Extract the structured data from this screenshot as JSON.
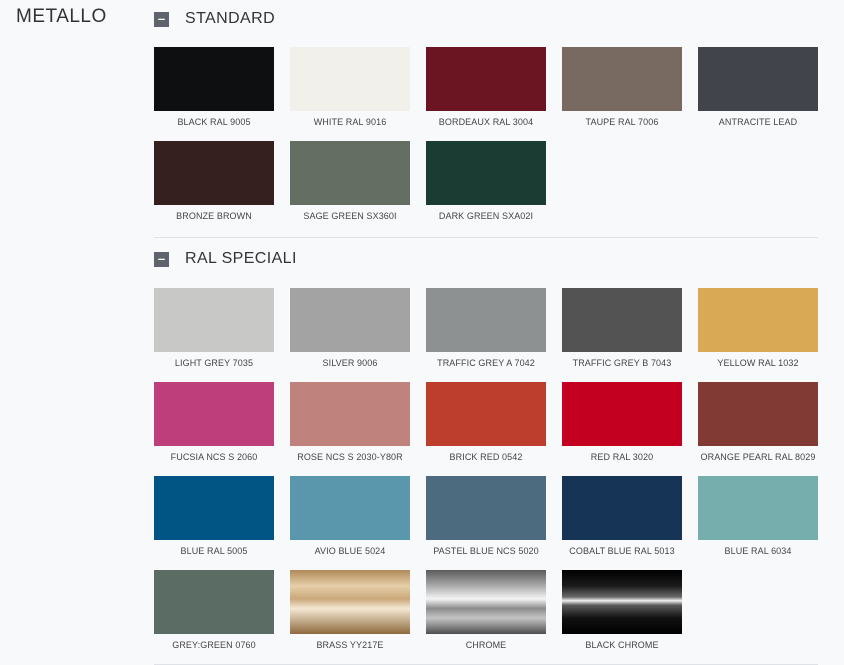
{
  "page_title": "METALLO",
  "toggle_symbol": "–",
  "sections": [
    {
      "title": "STANDARD",
      "swatches": [
        {
          "label": "BLACK RAL 9005",
          "color": "#0e0f11"
        },
        {
          "label": "WHITE RAL 9016",
          "color": "#f1f0eb"
        },
        {
          "label": "BORDEAUX RAL 3004",
          "color": "#6b1522"
        },
        {
          "label": "TAUPE RAL 7006",
          "color": "#786a60"
        },
        {
          "label": "ANTRACITE LEAD",
          "color": "#41444b"
        },
        {
          "label": "BRONZE BROWN",
          "color": "#35201f"
        },
        {
          "label": "SAGE GREEN SX360I",
          "color": "#646e62"
        },
        {
          "label": "DARK GREEN SXA02I",
          "color": "#1b3c33"
        }
      ]
    },
    {
      "title": "RAL SPECIALI",
      "swatches": [
        {
          "label": "LIGHT GREY 7035",
          "color": "#c8c9c6"
        },
        {
          "label": "SILVER 9006",
          "color": "#a3a3a3"
        },
        {
          "label": "TRAFFIC GREY A 7042",
          "color": "#8e9191"
        },
        {
          "label": "TRAFFIC GREY B 7043",
          "color": "#525352"
        },
        {
          "label": "YELLOW RAL 1032",
          "color": "#d9a955"
        },
        {
          "label": "FUCSIA NCS S 2060",
          "color": "#bd3e7a"
        },
        {
          "label": "ROSE NCS S 2030-Y80R",
          "color": "#c0827c"
        },
        {
          "label": "BRICK RED 0542",
          "color": "#be3e2e"
        },
        {
          "label": "RED RAL 3020",
          "color": "#c3001f"
        },
        {
          "label": "ORANGE PEARL RAL 8029",
          "color": "#823b34"
        },
        {
          "label": "BLUE RAL 5005",
          "color": "#005585"
        },
        {
          "label": "AVIO BLUE 5024",
          "color": "#5a97ac"
        },
        {
          "label": "PASTEL BLUE NCS 5020",
          "color": "#4c6b7f"
        },
        {
          "label": "COBALT BLUE RAL 5013",
          "color": "#163456"
        },
        {
          "label": "BLUE RAL 6034",
          "color": "#76aeae"
        },
        {
          "label": "GREY:GREEN 0760",
          "color": "#5a6c63"
        },
        {
          "label": "BRASS YY217E",
          "color": "linear-gradient(180deg,#b08a5a 0%,#e6cfa8 25%,#caa87a 45%,#f4e8d2 60%,#8f6a3e 100%)"
        },
        {
          "label": "CHROME",
          "color": "linear-gradient(180deg,#5b5b5b 0%,#9a9a9a 20%,#f4f4f4 45%,#8c8c8c 60%,#c4c4c4 75%,#4e4e4e 100%)"
        },
        {
          "label": "BLACK CHROME",
          "color": "linear-gradient(180deg,#000 0%,#1b1b1b 25%,#6a6a6a 42%,#f0f0f0 48%,#5a5a5a 55%,#111 75%,#000 100%)"
        }
      ]
    }
  ]
}
